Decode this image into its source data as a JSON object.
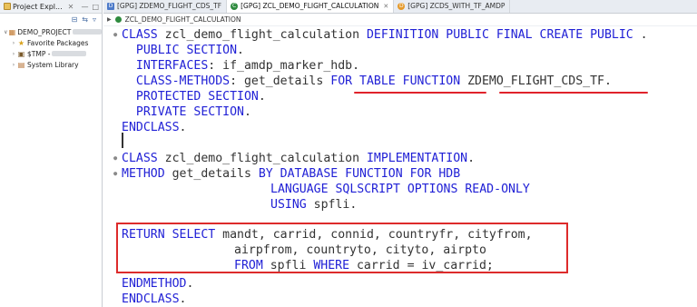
{
  "explorer": {
    "tab_label": "Project Expl...",
    "tab_close": "✕",
    "tree": [
      {
        "label": "DEMO_PROJECT",
        "arrow": "∨",
        "icon": "project-icon"
      },
      {
        "label": "Favorite Packages",
        "arrow": "›",
        "icon": "star-icon"
      },
      {
        "label": "$TMP -",
        "arrow": "›",
        "icon": "package-icon"
      },
      {
        "label": "System Library",
        "arrow": "›",
        "icon": "library-icon"
      }
    ]
  },
  "editor": {
    "tabs": [
      {
        "label": "[GPG] ZDEMO_FLIGHT_CDS_TF",
        "active": false,
        "icon": "ddl-icon"
      },
      {
        "label": "[GPG] ZCL_DEMO_FLIGHT_CALCULATION",
        "active": true,
        "icon": "class-icon",
        "close": "✕"
      },
      {
        "label": "[GPG] ZCDS_WITH_TF_AMDP",
        "active": false,
        "icon": "cds-icon"
      }
    ],
    "breadcrumb": "ZCL_DEMO_FLIGHT_CALCULATION"
  },
  "code": {
    "l1": {
      "a": "CLASS",
      "b": " zcl_demo_flight_calculation ",
      "c": "DEFINITION PUBLIC FINAL CREATE PUBLIC",
      "d": " ."
    },
    "l2": {
      "a": "  PUBLIC SECTION",
      "b": "."
    },
    "l3": {
      "a": "  INTERFACES",
      "b": ": if_amdp_marker_hdb."
    },
    "l4": {
      "a": "  CLASS-METHODS",
      "b": ": get_details ",
      "c": "FOR TABLE FUNCTION",
      "d": " ZDEMO_FLIGHT_CDS_TF."
    },
    "l5": {
      "a": "  PROTECTED SECTION",
      "b": "."
    },
    "l6": {
      "a": "  PRIVATE SECTION",
      "b": "."
    },
    "l7": {
      "a": "ENDCLASS",
      "b": "."
    },
    "l9": {
      "a": "CLASS",
      "b": " zcl_demo_flight_calculation ",
      "c": "IMPLEMENTATION",
      "d": "."
    },
    "l10": {
      "a": "METHOD",
      "b": " get_details ",
      "c": "BY DATABASE FUNCTION FOR HDB"
    },
    "l11": {
      "a": "LANGUAGE SQLSCRIPT OPTIONS READ-ONLY"
    },
    "l12": {
      "a": "USING",
      "b": " spfli."
    },
    "l14": {
      "a": "RETURN SELECT",
      "b": " mandt, carrid, connid, countryfr, cityfrom,"
    },
    "l15": {
      "a": "airpfrom, countryto, cityto, airpto"
    },
    "l16": {
      "a": "FROM",
      "b": " spfli ",
      "c": "WHERE",
      "d": " carrid = iv_carrid;"
    },
    "l17": {
      "a": "ENDMETHOD",
      "b": "."
    },
    "l18": {
      "a": "ENDCLASS",
      "b": "."
    }
  },
  "colors": {
    "keyword": "#2121d6",
    "identifier": "#333333",
    "highlight_box": "#dd2b2b",
    "underline": "#e0232b"
  }
}
